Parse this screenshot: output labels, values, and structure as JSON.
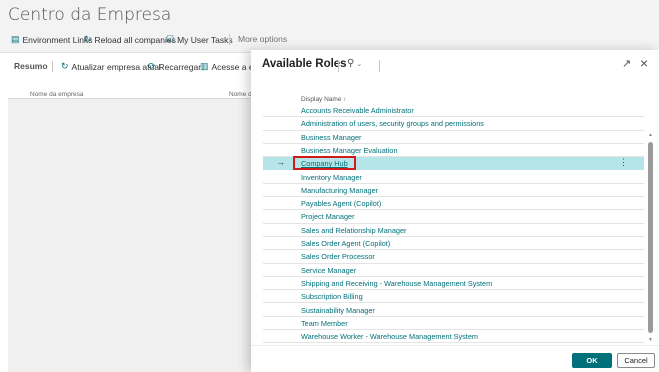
{
  "background": {
    "title": "Centro da Empresa",
    "actions": [
      {
        "label": "Environment Links",
        "icon": "link-icon"
      },
      {
        "label": "Reload all companies",
        "icon": "refresh-icon"
      },
      {
        "label": "My User Tasks",
        "icon": "tasks-icon"
      },
      {
        "label": "More options",
        "icon": ""
      }
    ],
    "tabs": [
      {
        "label": "Resumo"
      },
      {
        "label": "Atualizar empresa atual",
        "icon": "refresh-icon"
      },
      {
        "label": "Recarregar",
        "icon": "reload-icon"
      },
      {
        "label": "Acesse a empr",
        "icon": "open-icon"
      }
    ],
    "columns": [
      "Nome da empresa",
      "Nome do"
    ]
  },
  "dialog": {
    "title": "Available Roles",
    "column_header": "Display Name ↑",
    "roles": [
      "Accounts Receivable Administrator",
      "Administration of users, security groups and permissions",
      "Business Manager",
      "Business Manager Evaluation",
      "Company Hub",
      "Inventory Manager",
      "Manufacturing Manager",
      "Payables Agent (Copilot)",
      "Project Manager",
      "Sales and Relationship Manager",
      "Sales Order Agent (Copilot)",
      "Sales Order Processor",
      "Service Manager",
      "Shipping and Receiving - Warehouse Management System",
      "Subscription Billing",
      "Sustainability Manager",
      "Team Member",
      "Warehouse Worker - Warehouse Management System"
    ],
    "selected_role": "Company Hub",
    "ok_label": "OK",
    "cancel_label": "Cancel"
  },
  "colors": {
    "accent": "#00707a",
    "selected_row": "#b5e5e9",
    "highlight_border": "#d11a1a"
  }
}
